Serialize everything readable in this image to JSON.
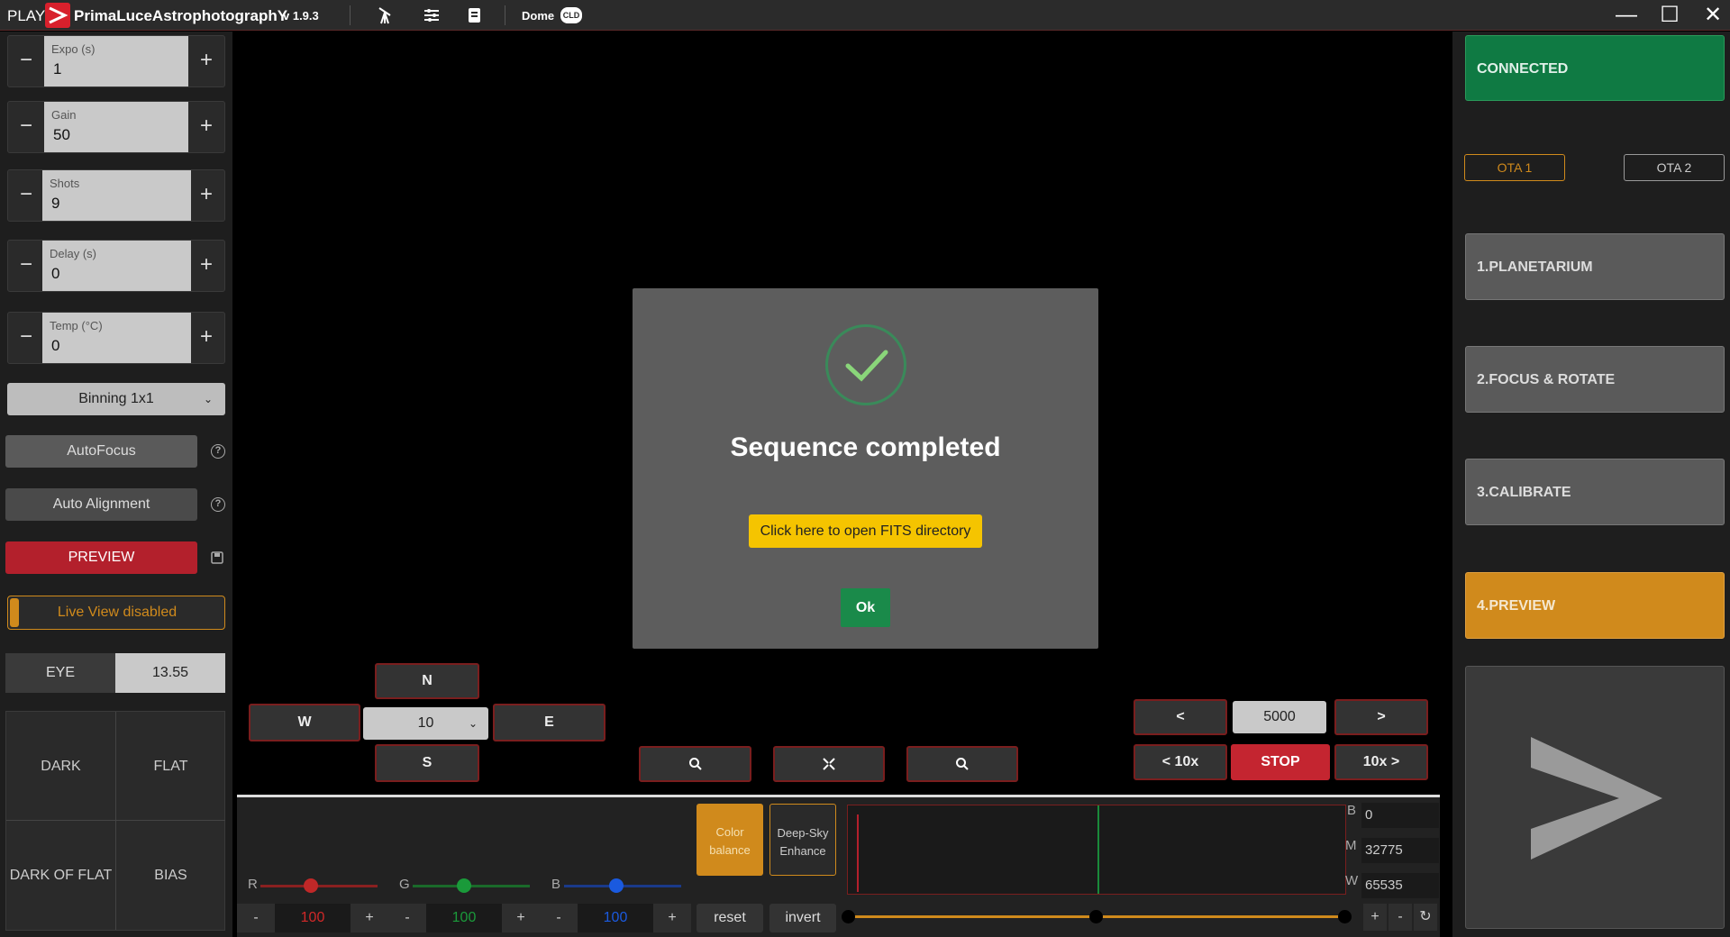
{
  "titlebar": {
    "play": "PLAY",
    "brand": "PrimaLuceAstrophotographY",
    "version": "v 1.9.3",
    "dome": "Dome",
    "cld": "CLD",
    "icons": [
      "telescope-icon",
      "sliders-icon",
      "notebook-icon"
    ],
    "min": "—",
    "max": "☐",
    "close": "✕"
  },
  "left": {
    "steppers": [
      {
        "label": "Expo (s)",
        "value": "1"
      },
      {
        "label": "Gain",
        "value": "50"
      },
      {
        "label": "Shots",
        "value": "9"
      },
      {
        "label": "Delay (s)",
        "value": "0"
      },
      {
        "label": "Temp (°C)",
        "value": "0"
      }
    ],
    "minus": "−",
    "plus": "+",
    "binning": "Binning 1x1",
    "autofocus": "AutoFocus",
    "auto_alignment": "Auto Alignment",
    "preview": "PREVIEW",
    "live_view": "Live View disabled",
    "eye_label": "EYE",
    "eye_value": "13.55",
    "calib": [
      "DARK",
      "FLAT",
      "DARK OF FLAT",
      "BIAS"
    ],
    "help": "?"
  },
  "nav": {
    "n": "N",
    "s": "S",
    "w": "W",
    "e": "E",
    "step": "10",
    "prev": "<",
    "next": ">",
    "value": "5000",
    "prev10": "< 10x",
    "next10": "10x >",
    "stop": "STOP"
  },
  "bottom": {
    "color_balance": "Color balance",
    "deep_sky": "Deep-Sky Enhance",
    "r_label": "R",
    "g_label": "G",
    "b_label": "B",
    "r_value": "100",
    "g_value": "100",
    "b_value": "100",
    "minus": "-",
    "plus": "+",
    "reset": "reset",
    "invert": "invert",
    "bmw": [
      {
        "label": "B",
        "value": "0"
      },
      {
        "label": "M",
        "value": "32775"
      },
      {
        "label": "W",
        "value": "65535"
      }
    ],
    "zoom_plus": "+",
    "zoom_minus": "-",
    "refresh": "↻"
  },
  "right": {
    "connected": "CONNECTED",
    "ota1": "OTA 1",
    "ota2": "OTA 2",
    "steps": [
      "1.PLANETARIUM",
      "2.FOCUS & ROTATE",
      "3.CALIBRATE",
      "4.PREVIEW"
    ],
    "go": ">"
  },
  "modal": {
    "title": "Sequence completed",
    "link": "Click here to open FITS directory",
    "ok": "Ok"
  },
  "colors": {
    "accent_orange": "#d08a1c",
    "connected_green": "#0f7a43",
    "stop_red": "#c42530",
    "preview_red": "#b3202c",
    "ok_green": "#1a8a4a",
    "link_yellow": "#f5c400"
  }
}
